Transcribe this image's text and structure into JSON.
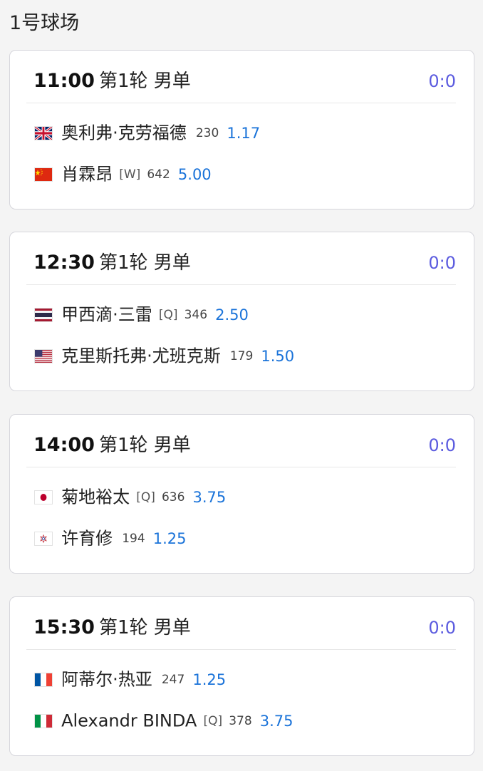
{
  "court": {
    "title": "1号球场"
  },
  "matches": [
    {
      "time": "11:00",
      "round": "第1轮 男单",
      "score": "0:0",
      "players": [
        {
          "flag": "uk-flag-icon",
          "name": "奥利弗·克劳福德",
          "tag": "",
          "rank": "230",
          "odds": "1.17"
        },
        {
          "flag": "china-flag-icon",
          "name": "肖霖昂",
          "tag": "[W]",
          "rank": "642",
          "odds": "5.00"
        }
      ]
    },
    {
      "time": "12:30",
      "round": "第1轮 男单",
      "score": "0:0",
      "players": [
        {
          "flag": "thailand-flag-icon",
          "name": "甲西滴·三雷",
          "tag": "[Q]",
          "rank": "346",
          "odds": "2.50"
        },
        {
          "flag": "usa-flag-icon",
          "name": "克里斯托弗·尤班克斯",
          "tag": "",
          "rank": "179",
          "odds": "1.50"
        }
      ]
    },
    {
      "time": "14:00",
      "round": "第1轮 男单",
      "score": "0:0",
      "players": [
        {
          "flag": "japan-flag-icon",
          "name": "菊地裕太",
          "tag": "[Q]",
          "rank": "636",
          "odds": "3.75"
        },
        {
          "flag": "chinese-taipei-flag-icon",
          "name": "许育修",
          "tag": "",
          "rank": "194",
          "odds": "1.25"
        }
      ]
    },
    {
      "time": "15:30",
      "round": "第1轮 男单",
      "score": "0:0",
      "players": [
        {
          "flag": "france-flag-icon",
          "name": "阿蒂尔·热亚",
          "tag": "",
          "rank": "247",
          "odds": "1.25"
        },
        {
          "flag": "italy-flag-icon",
          "name": "Alexandr BINDA",
          "tag": "[Q]",
          "rank": "378",
          "odds": "3.75"
        }
      ]
    }
  ],
  "colors": {
    "score": "#5b5bdf",
    "odds": "#1a73d9"
  }
}
